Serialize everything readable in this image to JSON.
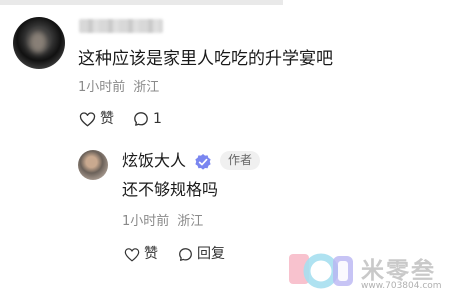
{
  "comment": {
    "text": "这种应该是家里人吃吃的升学宴吧",
    "time": "1小时前",
    "location": "浙江",
    "like_label": "赞",
    "reply_count": "1"
  },
  "reply": {
    "username": "炫饭大人",
    "author_tag": "作者",
    "text": "还不够规格吗",
    "time": "1小时前",
    "location": "浙江",
    "like_label": "赞",
    "reply_label": "回复"
  },
  "watermark": {
    "text": "米零叁",
    "url": "www.703804.com"
  },
  "icons": {
    "like": "heart-outline-icon",
    "comment": "speech-bubble-icon",
    "verified": "verified-badge-icon"
  },
  "colors": {
    "verified": "#7a86f0",
    "meta": "#8a8a8a"
  }
}
